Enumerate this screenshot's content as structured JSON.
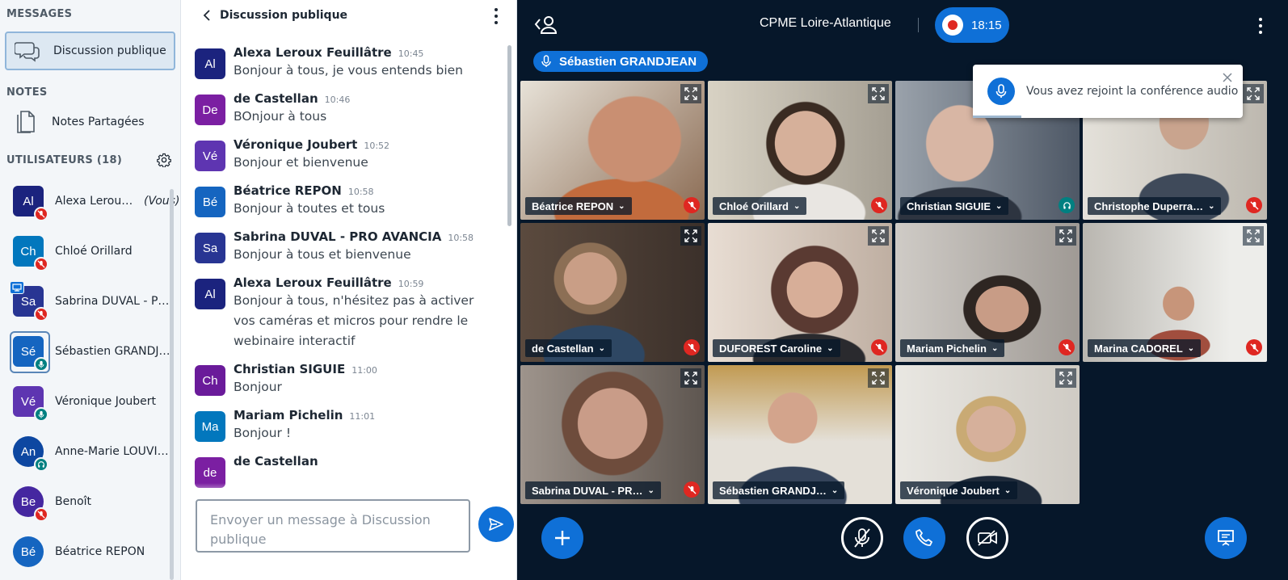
{
  "sidebar": {
    "messages_title": "MESSAGES",
    "public_chat_label": "Discussion publique",
    "notes_title": "NOTES",
    "shared_notes_label": "Notes Partagées",
    "users_title": "UTILISATEURS (18)",
    "you_label": "(Vous)",
    "users": [
      {
        "initials": "Al",
        "name": "Alexa Leroux …",
        "color": "#1B237E"
      },
      {
        "initials": "Ch",
        "name": "Chloé Orillard",
        "color": "#0277BD"
      },
      {
        "initials": "Sa",
        "name": "Sabrina DUVAL - PR…",
        "color": "#283593"
      },
      {
        "initials": "Sé",
        "name": "Sébastien GRANDJE…",
        "color": "#1565C0"
      },
      {
        "initials": "Vé",
        "name": "Véronique Joubert",
        "color": "#5E35B1"
      },
      {
        "initials": "An",
        "name": "Anne-Marie LOUVIG…",
        "color": "#0D47A1"
      },
      {
        "initials": "Be",
        "name": "Benoît",
        "color": "#4527A0"
      },
      {
        "initials": "Bé",
        "name": "Béatrice REPON",
        "color": "#1565C0"
      }
    ]
  },
  "chat": {
    "title": "Discussion publique",
    "placeholder": "Envoyer un message à Discussion publique",
    "messages": [
      {
        "initials": "Al",
        "author": "Alexa Leroux Feuillâtre",
        "time": "10:45",
        "text": "Bonjour à tous, je vous entends bien",
        "color": "#1B237E"
      },
      {
        "initials": "De",
        "author": "de Castellan",
        "time": "10:46",
        "text": "BOnjour à tous",
        "color": "#7B1FA2"
      },
      {
        "initials": "Vé",
        "author": "Véronique Joubert",
        "time": "10:52",
        "text": "Bonjour et bienvenue",
        "color": "#5E35B1"
      },
      {
        "initials": "Bé",
        "author": "Béatrice REPON",
        "time": "10:58",
        "text": "Bonjour à toutes et tous",
        "color": "#1565C0"
      },
      {
        "initials": "Sa",
        "author": "Sabrina DUVAL - PRO AVANCIA",
        "time": "10:58",
        "text": "Bonjour à tous et bienvenue",
        "color": "#283593"
      },
      {
        "initials": "Al",
        "author": "Alexa Leroux Feuillâtre",
        "time": "10:59",
        "text": "Bonjour à tous, n'hésitez pas à activer vos caméras et micros pour rendre le webinaire interactif",
        "color": "#1B237E"
      },
      {
        "initials": "Ch",
        "author": "Christian SIGUIE",
        "time": "11:00",
        "text": "Bonjour",
        "color": "#6A1B9A"
      },
      {
        "initials": "Ma",
        "author": "Mariam Pichelin",
        "time": "11:01",
        "text": "Bonjour !",
        "color": "#0277BD"
      },
      {
        "initials": "de",
        "author": "de Castellan",
        "time": "",
        "text": "",
        "color": "#7B1FA2"
      }
    ]
  },
  "conference": {
    "title": "CPME Loire-Atlantique",
    "recording_time": "18:15",
    "talking": "Sébastien GRANDJEAN",
    "toast": "Vous avez rejoint la conférence audio",
    "tiles": [
      {
        "name": "Béatrice REPON",
        "status": "muted",
        "bg": "#8A6A52"
      },
      {
        "name": "Chloé Orillard",
        "status": "muted",
        "bg": "#B9B3A6"
      },
      {
        "name": "Christian SIGUIE",
        "status": "listen",
        "bg": "#6F7A86"
      },
      {
        "name": "Christophe Duperra…",
        "status": "muted",
        "bg": "#C7C3BA"
      },
      {
        "name": "de Castellan",
        "status": "muted",
        "bg": "#6B5A4C"
      },
      {
        "name": "DUFOREST Caroline",
        "status": "muted",
        "bg": "#C9B9AE"
      },
      {
        "name": "Mariam Pichelin",
        "status": "muted",
        "bg": "#B7B3AE"
      },
      {
        "name": "Marina CADOREL",
        "status": "muted",
        "bg": "#A9A59F"
      },
      {
        "name": "Sabrina DUVAL - PR…",
        "status": "muted",
        "bg": "#7C6F66"
      },
      {
        "name": "Sébastien GRANDJ…",
        "status": "none",
        "bg": "#8B7A5C"
      },
      {
        "name": "Véronique Joubert",
        "status": "none",
        "bg": "#D8D4CC"
      }
    ]
  },
  "colors": {
    "accent": "#0F70D7",
    "muted": "#DF2721",
    "listen": "#008081",
    "background": "#06172A"
  }
}
